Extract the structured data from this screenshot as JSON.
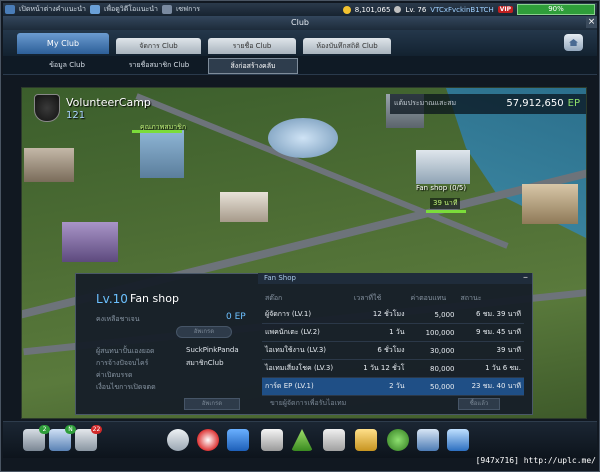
{
  "topbar": {
    "news1": "เปิดหน้าต่างคำแนะนำ",
    "news2": "เพื่อดูวิดีโอแนะนำ",
    "news3": "เซฟการ",
    "coins": "8,101,065",
    "level": "Lv. 76",
    "username": "VTCxFvckinB1TCH",
    "vip": "VIP",
    "battery": "90%"
  },
  "title": "Club",
  "tabs": [
    "My Club",
    "จัดการ Club",
    "รายชื่อ Club",
    "ห้องบันทึกสถิติ Club"
  ],
  "subtabs": [
    "ข้อมูล Club",
    "รายชื่อสมาชิก Club",
    "สิ่งก่อสร้างคลับ"
  ],
  "club": {
    "name": "VolunteerCamp",
    "number": "121",
    "ep_label": "แต้มประมาณแสะสม",
    "ep_value": "57,912,650",
    "ep_unit": "EP"
  },
  "map_labels": {
    "hq": "คุณภาพสมาชิก",
    "fanshop": "Fan shop (0/5)",
    "fanshop_tag": "39 นาที"
  },
  "panel": {
    "header": "Fan Shop",
    "close": "–",
    "level": "Lv.10",
    "name": "Fan shop",
    "row1_label": "คงเหลือชาเจน",
    "ep_amount": "0",
    "ep_unit": "EP",
    "upgrade_btn": "อัพเกรด",
    "row2_label": "ผู้สนทนาปั้นเองยอด",
    "row2_value": "SuckPinkPanda",
    "row3_label": "การจ้างปัจจบไคร์",
    "row3_value": "สมาชิกClub",
    "row4_label": "ค่าเปิดบรรด",
    "row5_label": "เงื่อนไขการเปิดจตด",
    "left_btn": "อัพเกรด",
    "columns": [
      "สต๊อก",
      "เวลาที่ใช้",
      "ค่าตอบแทน",
      "สถานะ"
    ],
    "rows": [
      [
        "ผู้จัดการ (LV.1)",
        "12 ชั่วโมง",
        "5,000",
        "6 ชม. 39 นาที"
      ],
      [
        "แพคนักเตะ (LV.2)",
        "1 วัน",
        "100,000",
        "9 ชม. 45 นาที"
      ],
      [
        "ไอเทมใช้งาน (LV.3)",
        "6 ชั่วโมง",
        "30,000",
        "39 นาที"
      ],
      [
        "ไอเทมเสี่ยงโชค (LV.3)",
        "1 วัน 12 ชั่วโ",
        "80,000",
        "1 วัน 6 ชม."
      ],
      [
        "การ์ด EP (LV.1)",
        "2 วัน",
        "50,000",
        "23 ชม. 40 นาที"
      ]
    ],
    "footer": "ขายผู้จัดการเพื่อรับไอเทม",
    "right_btn": "ซื้อแล้ว"
  },
  "toolbar": {
    "badges": [
      "2",
      "N",
      "22"
    ]
  },
  "watermark": "[947x716] http://uplc.me/"
}
